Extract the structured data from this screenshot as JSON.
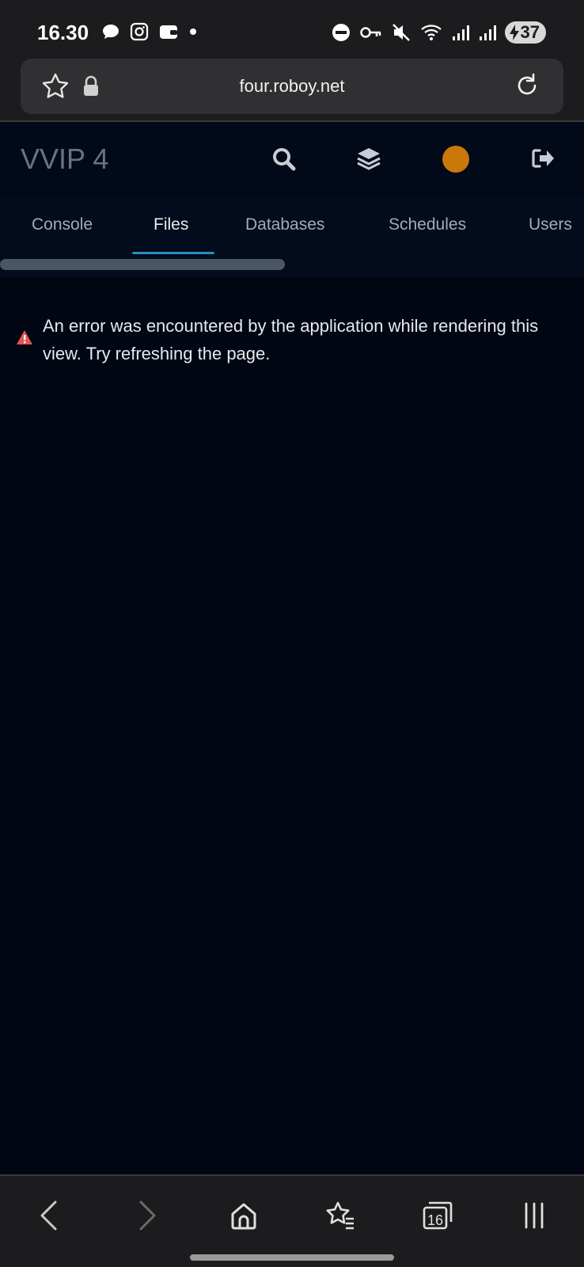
{
  "status_bar": {
    "time": "16.30",
    "battery": "37"
  },
  "browser": {
    "url": "four.roboy.net",
    "tab_count": "16"
  },
  "app": {
    "title": "VVIP 4",
    "avatar_color": "#c9780a",
    "tabs": [
      {
        "label": "Console",
        "active": false
      },
      {
        "label": "Files",
        "active": true
      },
      {
        "label": "Databases",
        "active": false
      },
      {
        "label": "Schedules",
        "active": false
      },
      {
        "label": "Users",
        "active": false
      }
    ],
    "accent_color": "#2a8fc4"
  },
  "error": {
    "message": "An error was encountered by the application while rendering this view. Try refreshing the page.",
    "icon": "warning-triangle-icon",
    "color": "#e05555"
  }
}
